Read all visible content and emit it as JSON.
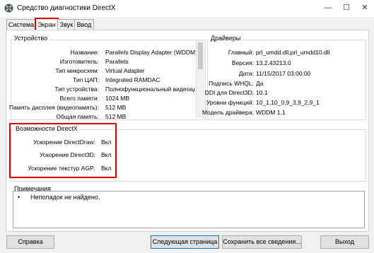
{
  "window": {
    "title": "Средство диагностики DirectX",
    "minimize_glyph": "—",
    "maximize_glyph": "☐",
    "close_glyph": "✕"
  },
  "tabs": [
    {
      "label": "Система"
    },
    {
      "label": "Экран"
    },
    {
      "label": "Звук"
    },
    {
      "label": "Ввод"
    }
  ],
  "device": {
    "heading": "Устройство",
    "rows": [
      {
        "label": "Название:",
        "value": "Parallels Display Adapter (WDDM)"
      },
      {
        "label": "Изготовитель:",
        "value": "Parallels"
      },
      {
        "label": "Тип микросхем:",
        "value": "Virtual Adapter"
      },
      {
        "label": "Тип ЦАП:",
        "value": "Integrated RAMDAC"
      },
      {
        "label": "Тип устройства:",
        "value": "Полнофункциональный видеоадапте"
      },
      {
        "label": "Всего памяти:",
        "value": "1024 MB"
      },
      {
        "label": "Память дисплея (видеопамять):",
        "value": "512 MB"
      },
      {
        "label": "Общая память:",
        "value": "512 MB"
      }
    ]
  },
  "drivers": {
    "heading": "Драйверы",
    "rows": [
      {
        "label": "Главный:",
        "value": "prl_umdd.dll,prl_umdd10.dll"
      },
      {
        "label": "Версия:",
        "value": "13.2.43213.0"
      },
      {
        "label": "Дата:",
        "value": "11/15/2017 03:00:00"
      },
      {
        "label": "Подпись WHQL:",
        "value": "Да"
      },
      {
        "label": "DDI для Direct3D:",
        "value": "10.1"
      },
      {
        "label": "Уровни функций:",
        "value": "10_1,10_0,9_3,9_2,9_1"
      },
      {
        "label": "Модель драйвера:",
        "value": "WDDM 1.1"
      }
    ]
  },
  "directx": {
    "heading": "Возможности DirectX",
    "rows": [
      {
        "label": "Ускорение DirectDraw:",
        "value": "Вкл"
      },
      {
        "label": "Ускорение Direct3D:",
        "value": "Вкл"
      },
      {
        "label": "Ускорение текстур AGP:",
        "value": "Вкл"
      }
    ]
  },
  "notes": {
    "heading": "Примечания",
    "bullet": "•",
    "text": "Неполадок не найдено."
  },
  "buttons": {
    "help": "Справка",
    "next": "Следующая страница",
    "save": "Сохранить все сведения...",
    "exit": "Выход"
  },
  "colors": {
    "highlight": "#e00000",
    "accent": "#0078d7"
  }
}
